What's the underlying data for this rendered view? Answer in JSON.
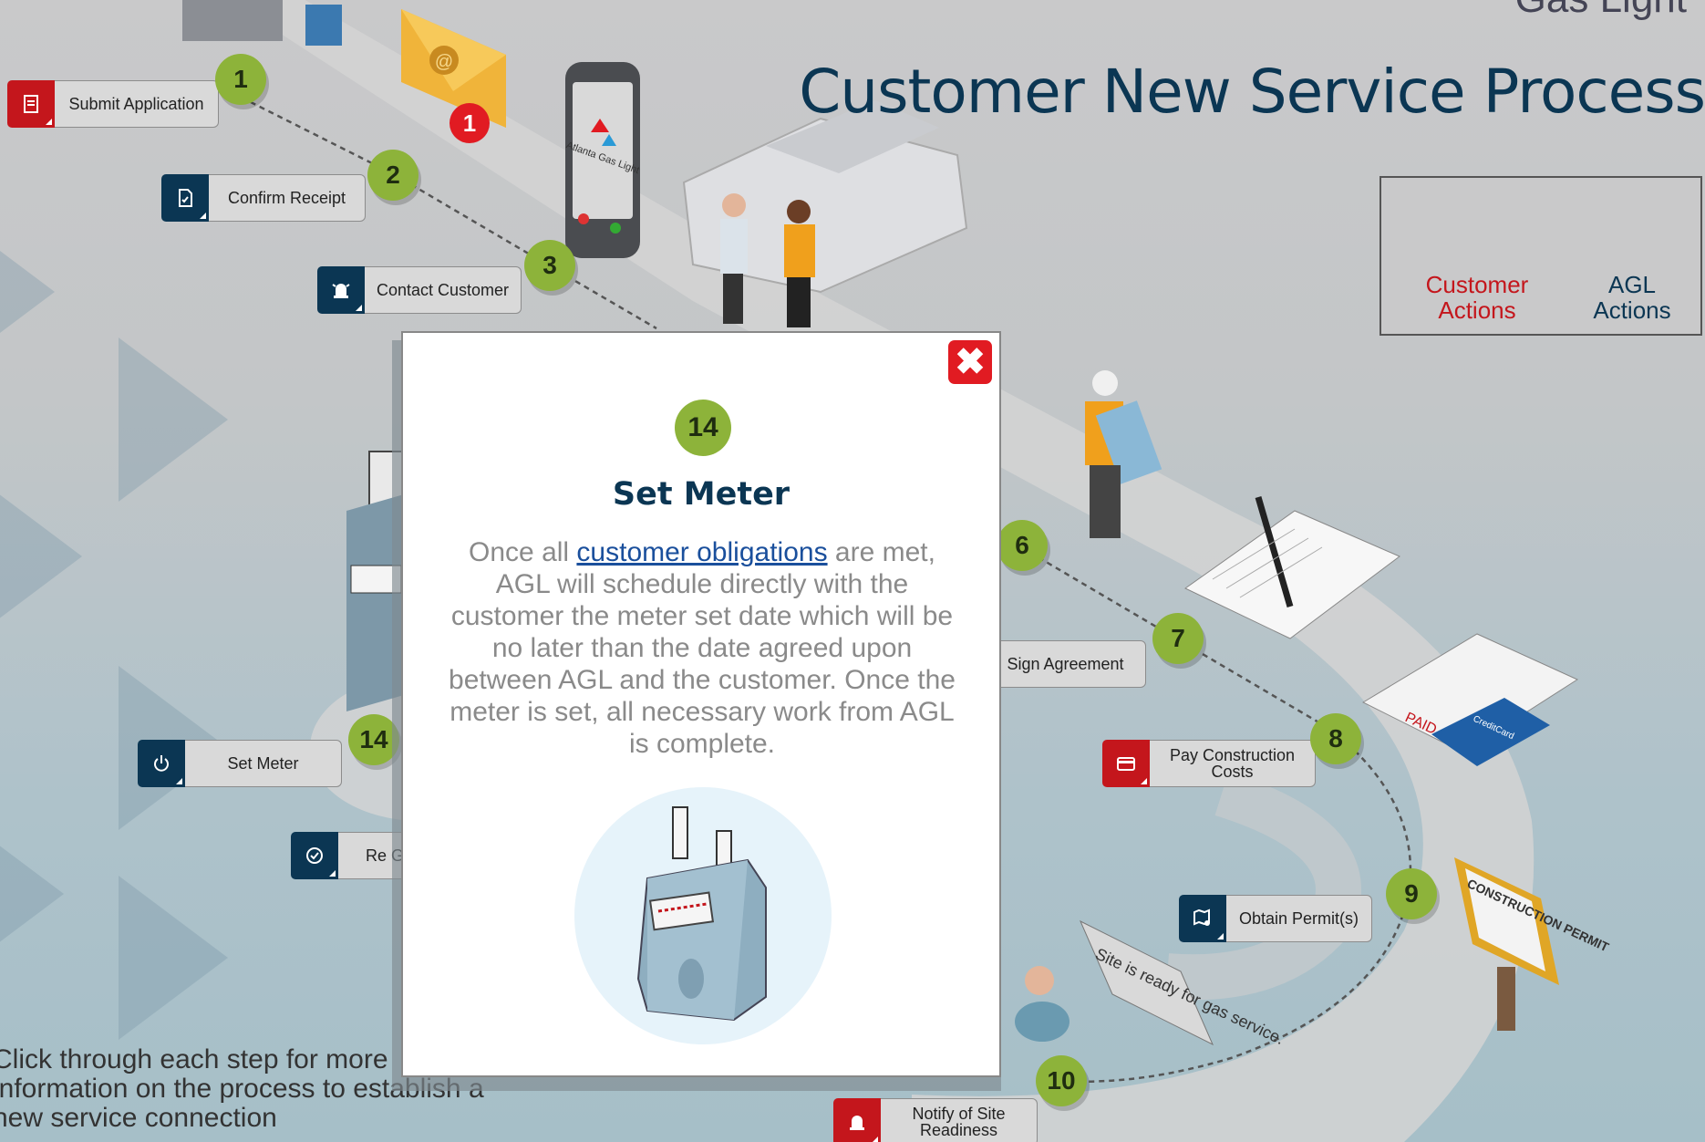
{
  "header": {
    "company_partial": "Gas Light",
    "title": "Customer New Service Process"
  },
  "legend": {
    "customer_label": "Customer Actions",
    "agl_label": "AGL Actions",
    "customer_color": "#c4161c",
    "agl_color": "#0b3653"
  },
  "steps": [
    {
      "number": "1",
      "label": "Submit Application",
      "actor": "customer",
      "icon": "form-icon"
    },
    {
      "number": "2",
      "label": "Confirm Receipt",
      "actor": "agl",
      "icon": "document-check-icon"
    },
    {
      "number": "3",
      "label": "Contact Customer",
      "actor": "agl",
      "icon": "alarm-bell-icon"
    },
    {
      "number": "6",
      "label": "Sign Agreement",
      "actor": "customer",
      "icon": ""
    },
    {
      "number": "7",
      "label": "",
      "actor": "",
      "icon": ""
    },
    {
      "number": "8",
      "label": "Pay Construction Costs",
      "actor": "customer",
      "icon": "credit-card-icon"
    },
    {
      "number": "9",
      "label": "Obtain Permit(s)",
      "actor": "agl",
      "icon": "map-pin-icon"
    },
    {
      "number": "10",
      "label": "Notify of Site Readiness",
      "actor": "customer",
      "icon": "alarm-bell-icon"
    },
    {
      "number": "14",
      "label": "Set Meter",
      "actor": "agl",
      "icon": "power-icon"
    },
    {
      "number": "",
      "label": "Re Gas",
      "actor": "agl",
      "icon": "check-circle-icon"
    }
  ],
  "scene_text": {
    "phone_brand": "Atlanta Gas Light",
    "speech_bubble": "Site is ready for gas service.",
    "permit_sign": "CONSTRUCTION PERMIT",
    "paid_stamp": "PAID",
    "card_label": "CreditCard",
    "email_badge": "1"
  },
  "hint": "Click through each step for more information on the process to establish a new service connection",
  "modal": {
    "step_number": "14",
    "title": "Set Meter",
    "text_before": "Once all ",
    "link_text": "customer obligations",
    "text_after": " are met, AGL will schedule directly with the customer the meter set date which will be no later than the date agreed upon between AGL and the customer. Once the meter is set, all necessary work from AGL is complete.",
    "close_label": "✖"
  }
}
